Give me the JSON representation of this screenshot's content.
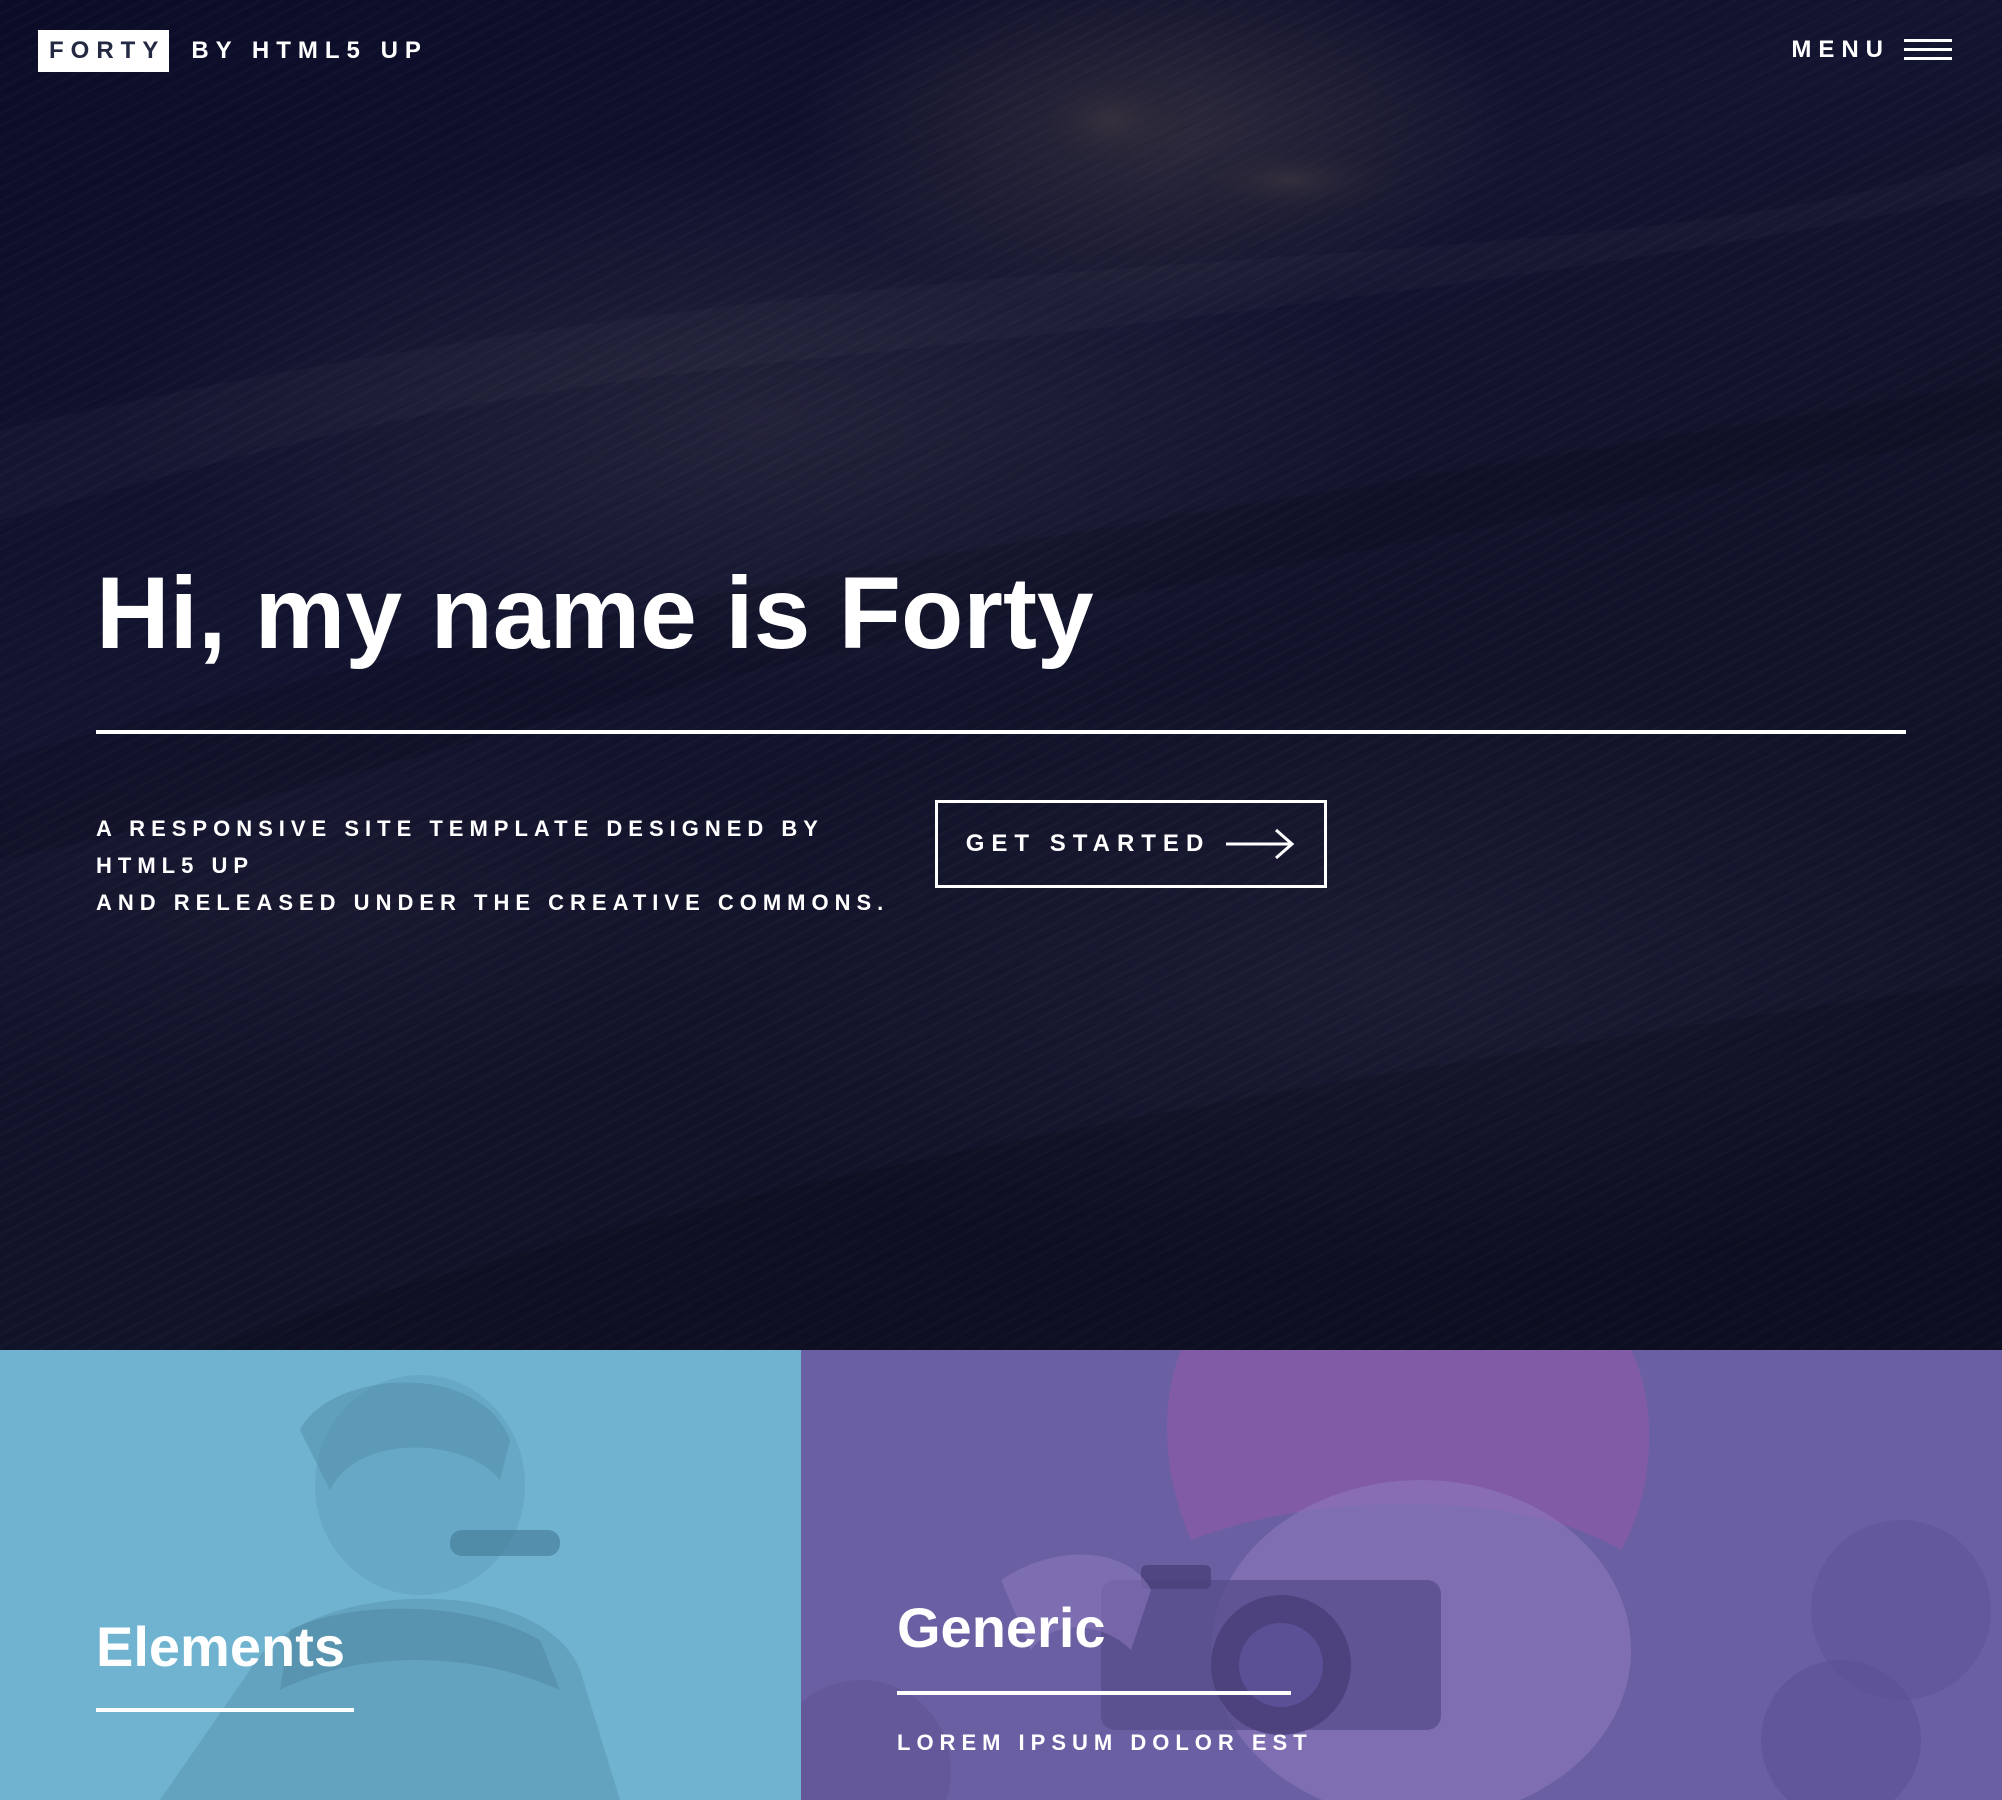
{
  "header": {
    "logo_box": "FORTY",
    "logo_suffix": "BY HTML5 UP",
    "menu_label": "MENU",
    "menu_icon": "hamburger-icon"
  },
  "hero": {
    "title": "Hi, my name is Forty",
    "tagline_line1": "A RESPONSIVE SITE TEMPLATE DESIGNED BY HTML5 UP",
    "tagline_line2": "AND RELEASED UNDER THE CREATIVE COMMONS.",
    "cta_label": "GET STARTED",
    "cta_icon": "arrow-right-icon",
    "background_color": "#121430"
  },
  "tiles": [
    {
      "title": "Elements",
      "subtitle": "",
      "color": "#6fb3d0"
    },
    {
      "title": "Generic",
      "subtitle": "LOREM IPSUM DOLOR EST",
      "color": "#6b5fa3"
    }
  ],
  "colors": {
    "text": "#ffffff",
    "logo_box_text": "#242943"
  }
}
